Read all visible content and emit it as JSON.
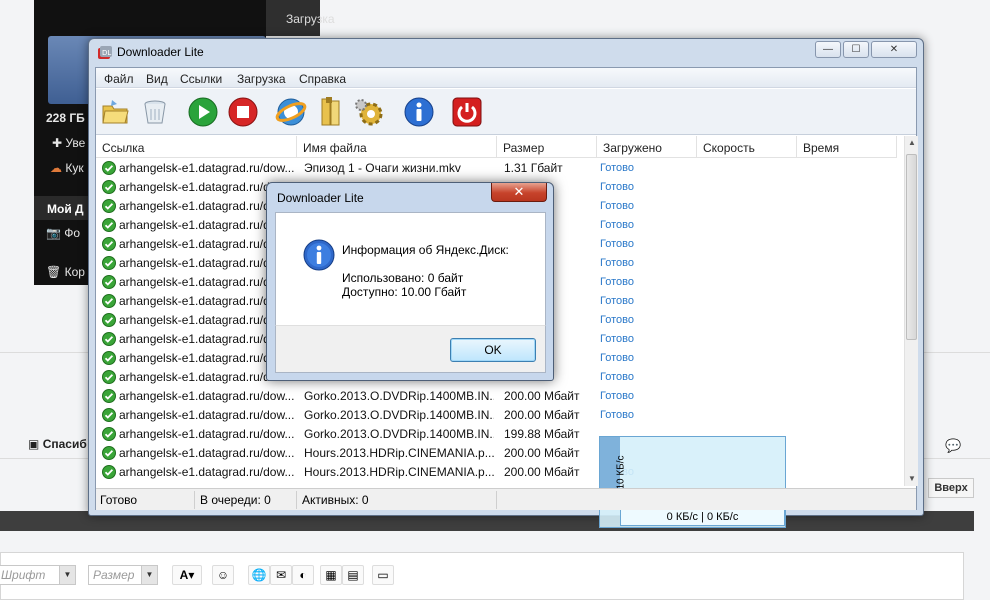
{
  "background": {
    "top_tab": "Загрузка",
    "storage": "228 ГБ",
    "sb_items": [
      "Уве",
      "Кук"
    ],
    "sb_menu": "Мой Д",
    "sb_sub": [
      "Фо",
      "Кор"
    ],
    "spasibo": "Спасиб",
    "up_button": "Вверх",
    "editor": {
      "font_combo": "Шрифт",
      "size_combo": "Размер",
      "text_color": "A"
    }
  },
  "window": {
    "title": "Downloader Lite",
    "controls": {
      "min": "—",
      "max": "☐",
      "close": "✕"
    },
    "menu": [
      "Файл",
      "Вид",
      "Ссылки",
      "Загрузка",
      "Справка"
    ],
    "toolbar_icons": [
      "open-folder-icon",
      "recycle-bin-icon",
      "start-icon",
      "stop-icon",
      "ie-browser-icon",
      "folder-books-icon",
      "settings-gear-icon",
      "info-icon",
      "power-icon"
    ],
    "columns": [
      "Ссылка",
      "Имя файла",
      "Размер",
      "Загружено",
      "Скорость",
      "Время"
    ],
    "rows": [
      {
        "link": "arhangelsk-e1.datagrad.ru/dow...",
        "name": "Эпизод 1 - Очаги жизни.mkv",
        "size": "1.31 Гбайт",
        "done": "Готово"
      },
      {
        "link": "arhangelsk-e1.datagrad.ru/d",
        "name": "",
        "size": "",
        "done": "Готово"
      },
      {
        "link": "arhangelsk-e1.datagrad.ru/d",
        "name": "",
        "size": "",
        "done": "Готово"
      },
      {
        "link": "arhangelsk-e1.datagrad.ru/d",
        "name": "",
        "size": "",
        "done": "Готово"
      },
      {
        "link": "arhangelsk-e1.datagrad.ru/d",
        "name": "",
        "size": "",
        "done": "Готово"
      },
      {
        "link": "arhangelsk-e1.datagrad.ru/d",
        "name": "",
        "size": "",
        "done": "Готово"
      },
      {
        "link": "arhangelsk-e1.datagrad.ru/d",
        "name": "",
        "size": "",
        "done": "Готово"
      },
      {
        "link": "arhangelsk-e1.datagrad.ru/d",
        "name": "",
        "size": "",
        "done": "Готово"
      },
      {
        "link": "arhangelsk-e1.datagrad.ru/d",
        "name": "",
        "size": "байт",
        "done": "Готово"
      },
      {
        "link": "arhangelsk-e1.datagrad.ru/d",
        "name": "",
        "size": "байт",
        "done": "Готово"
      },
      {
        "link": "arhangelsk-e1.datagrad.ru/d",
        "name": "",
        "size": "байт",
        "done": "Готово"
      },
      {
        "link": "arhangelsk-e1.datagrad.ru/d",
        "name": "",
        "size": "байт",
        "done": "Готово"
      },
      {
        "link": "arhangelsk-e1.datagrad.ru/dow...",
        "name": "Gorko.2013.O.DVDRip.1400MB.IN...",
        "size": "200.00 Мбайт",
        "done": "Готово"
      },
      {
        "link": "arhangelsk-e1.datagrad.ru/dow...",
        "name": "Gorko.2013.O.DVDRip.1400MB.IN...",
        "size": "200.00 Мбайт",
        "done": "Готово"
      },
      {
        "link": "arhangelsk-e1.datagrad.ru/dow...",
        "name": "Gorko.2013.O.DVDRip.1400MB.IN...",
        "size": "199.88 Мбайт",
        "done": ""
      },
      {
        "link": "arhangelsk-e1.datagrad.ru/dow...",
        "name": "Hours.2013.HDRip.CINEMANIA.p...",
        "size": "200.00 Мбайт",
        "done": ""
      },
      {
        "link": "arhangelsk-e1.datagrad.ru/dow...",
        "name": "Hours.2013.HDRip.CINEMANIA.p...",
        "size": "200.00 Мбайт",
        "done": "Готово"
      }
    ],
    "speed_widget": {
      "axis_label": "10 КБ/с",
      "readout": "0 КБ/с | 0 КБ/с"
    },
    "status": {
      "state": "Готово",
      "queue": "В очереди: 0",
      "active": "Активных: 0"
    }
  },
  "dialog": {
    "title": "Downloader Lite",
    "close": "✕",
    "heading": "Информация об Яндекс.Диск:",
    "used": "Использовано: 0 байт",
    "available": "Доступно: 10.00 Гбайт",
    "ok": "OK"
  }
}
